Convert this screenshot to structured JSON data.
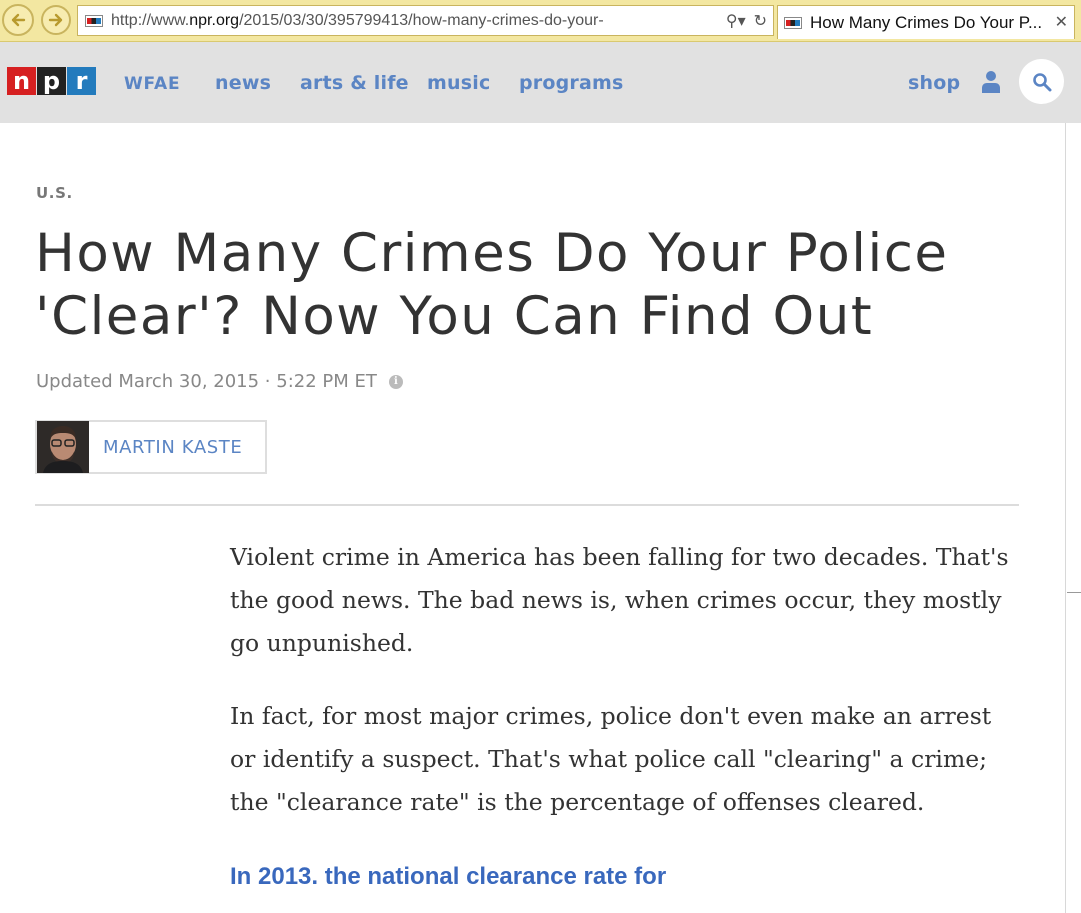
{
  "browser": {
    "url_prefix": "http://www.",
    "url_domain": "npr.org",
    "url_path": "/2015/03/30/395799413/how-many-crimes-do-your-",
    "tab_title": "How Many Crimes Do Your P...",
    "favicon_text": "NPR"
  },
  "header": {
    "logo": [
      "n",
      "p",
      "r"
    ],
    "station": "WFAE",
    "nav": [
      "news",
      "arts & life",
      "music",
      "programs"
    ],
    "shop": "shop",
    "colors": {
      "red": "#d62021",
      "black": "#222222",
      "blue": "#237bbd",
      "link": "#5b85c4"
    }
  },
  "article": {
    "section": "U.S.",
    "headline": "How Many Crimes Do Your Police 'Clear'? Now You Can Find Out",
    "dateline": "Updated March 30, 2015 · 5:22 PM ET",
    "author": "MARTIN KASTE",
    "paragraphs": [
      "Violent crime in America has been falling for two decades. That's the good news. The bad news is, when crimes occur, they mostly go unpunished.",
      "In fact, for most major crimes, police don't even make an arrest or identify a suspect. That's what police call \"clearing\" a crime; the \"clearance rate\" is the percentage of offenses cleared.",
      "In 2013, the national clearance rate for"
    ]
  }
}
